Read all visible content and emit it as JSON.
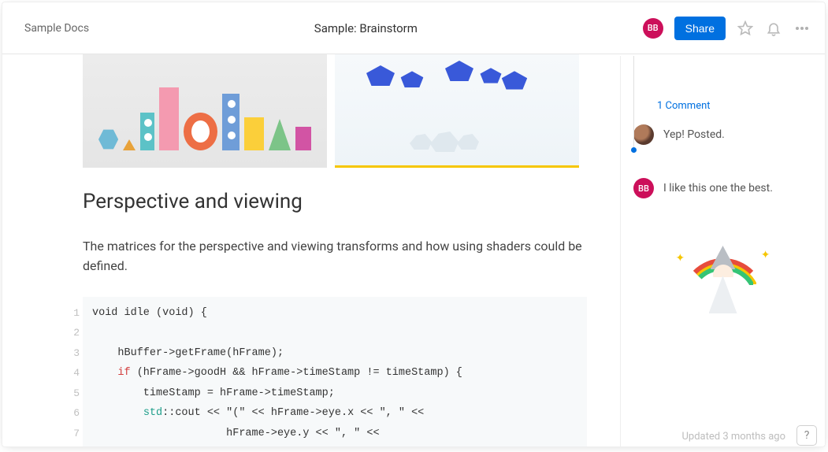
{
  "header": {
    "folder": "Sample Docs",
    "title": "Sample: Brainstorm",
    "avatar_initials": "BB",
    "share_label": "Share"
  },
  "doc": {
    "section_title": "Perspective and viewing",
    "body": "The matrices for the perspective and viewing transforms and how using shaders could be defined.",
    "code_lines": [
      {
        "n": "1",
        "pre": "void idle (void) {",
        "red": "",
        "post": ""
      },
      {
        "n": "2",
        "pre": "",
        "red": "",
        "post": ""
      },
      {
        "n": "3",
        "pre": "    hBuffer->getFrame(hFrame);",
        "red": "",
        "post": ""
      },
      {
        "n": "4",
        "pre": "    ",
        "red": "if",
        "post": " (hFrame->goodH && hFrame->timeStamp != timeStamp) {"
      },
      {
        "n": "5",
        "pre": "        timeStamp = hFrame->timeStamp;",
        "red": "",
        "post": ""
      },
      {
        "n": "6",
        "pre": "        ",
        "teal": "std",
        "post": "::cout << \"(\" << hFrame->eye.x << \", \" <<"
      },
      {
        "n": "7",
        "pre": "                     hFrame->eye.y << \", \" <<",
        "red": "",
        "post": ""
      }
    ]
  },
  "sidebar": {
    "comments_link": "1 Comment",
    "comments": [
      {
        "avatar": "photo",
        "text": "Yep! Posted."
      },
      {
        "avatar": "BB",
        "text": "I like this one the best."
      }
    ],
    "updated": "Updated 3 months ago",
    "help": "?"
  }
}
